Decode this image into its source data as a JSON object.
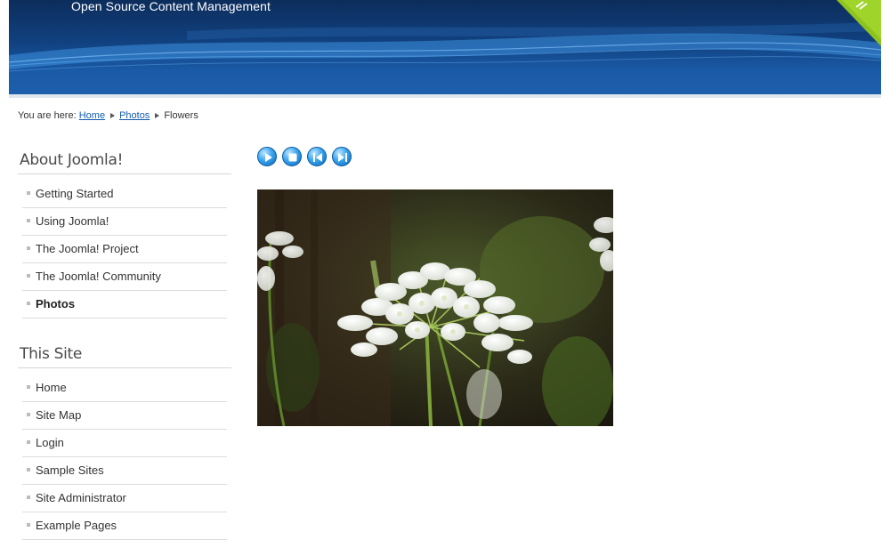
{
  "header": {
    "tagline": "Open Source Content Management"
  },
  "breadcrumb": {
    "prefix": "You are here:",
    "items": [
      "Home",
      "Photos"
    ],
    "current": "Flowers"
  },
  "modules": [
    {
      "title": "About Joomla!",
      "items": [
        {
          "label": "Getting Started"
        },
        {
          "label": "Using Joomla!"
        },
        {
          "label": "The Joomla! Project"
        },
        {
          "label": "The Joomla! Community"
        },
        {
          "label": "Photos",
          "active": true
        }
      ]
    },
    {
      "title": "This Site",
      "items": [
        {
          "label": "Home"
        },
        {
          "label": "Site Map"
        },
        {
          "label": "Login"
        },
        {
          "label": "Sample Sites"
        },
        {
          "label": "Site Administrator"
        },
        {
          "label": "Example Pages"
        }
      ]
    }
  ],
  "slideshow": {
    "controls": [
      "play-icon",
      "stop-icon",
      "previous-icon",
      "next-icon"
    ]
  },
  "colors": {
    "header_dark": "#0c2d5c",
    "header_light": "#1e5fad",
    "link": "#135cae",
    "corner_accent": "#8dc21f"
  }
}
